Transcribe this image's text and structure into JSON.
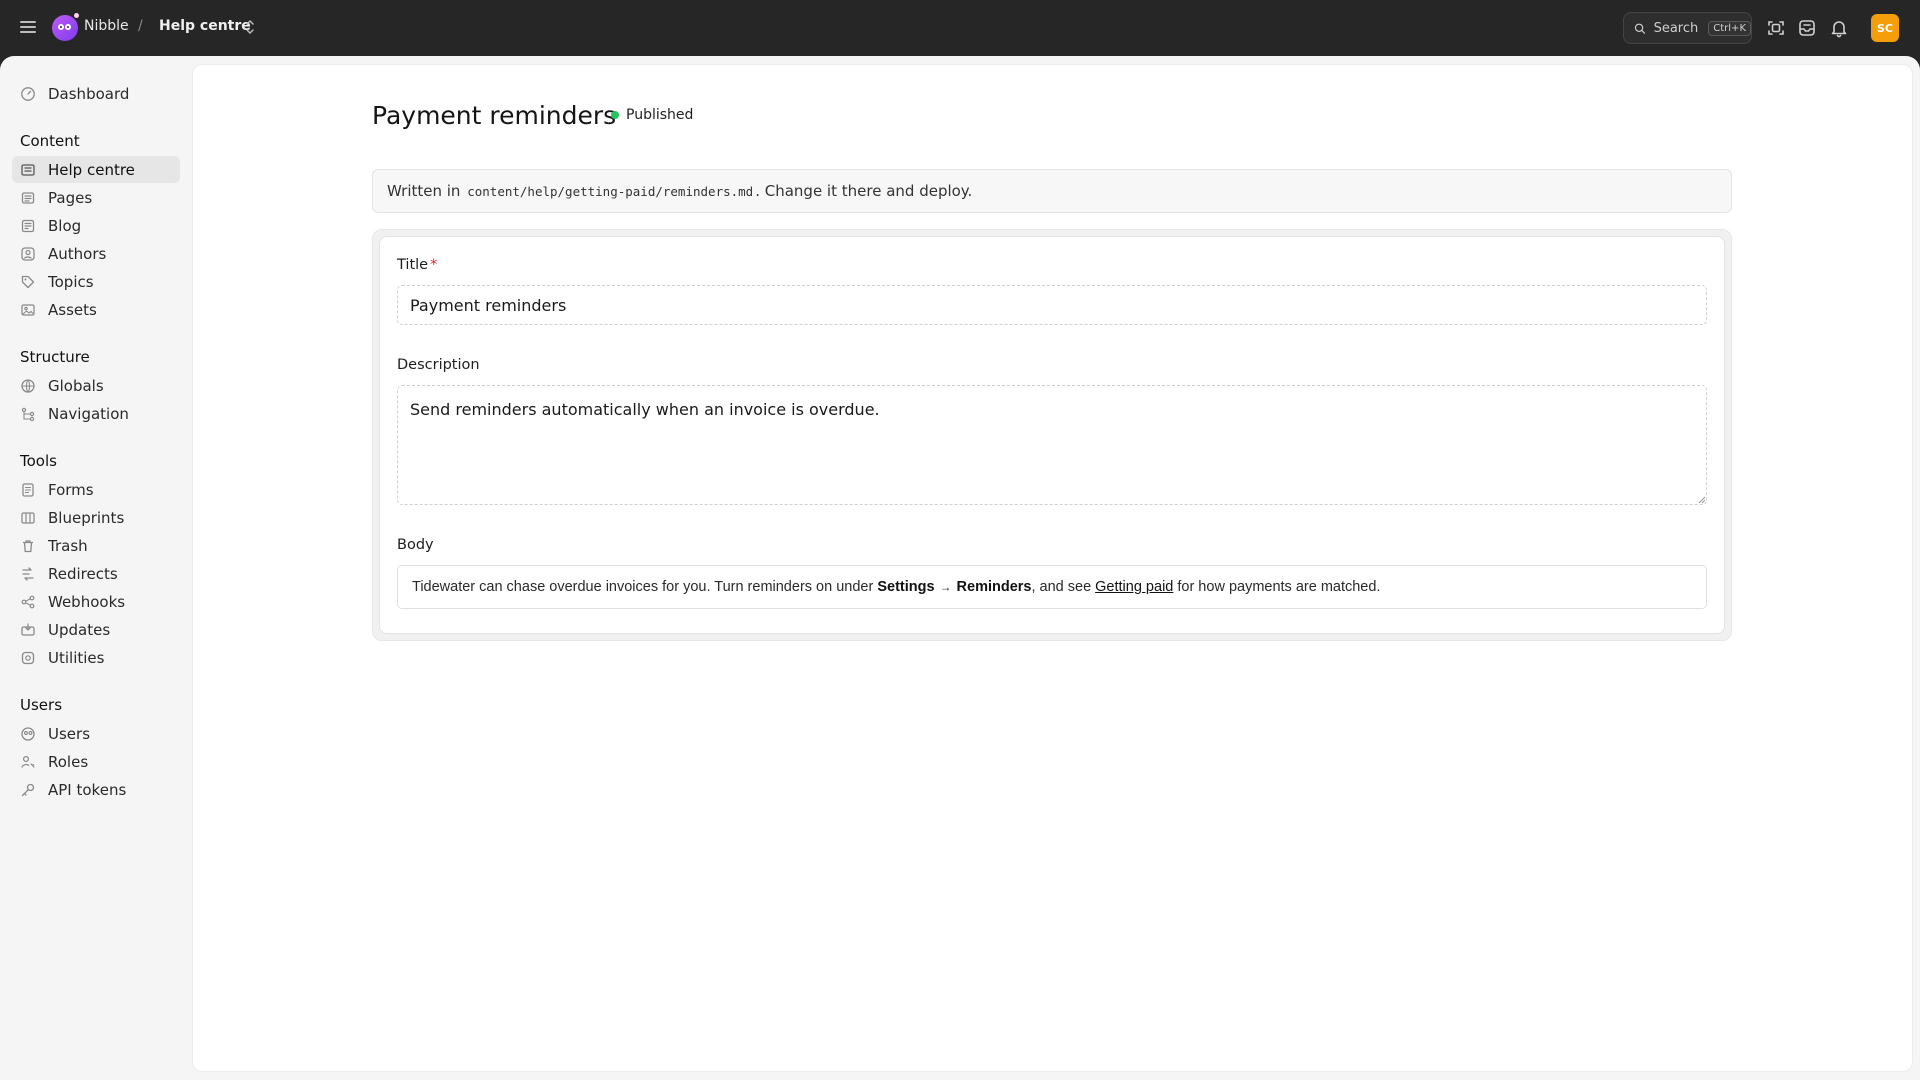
{
  "topbar": {
    "brand": "Nibble",
    "separator": "/",
    "crumb": "Help centre",
    "search_label": "Search",
    "search_shortcut": "Ctrl+K",
    "avatar_initials": "SC"
  },
  "sidebar": {
    "dashboard": "Dashboard",
    "sections": {
      "content": "Content",
      "structure": "Structure",
      "tools": "Tools",
      "users": "Users"
    },
    "content_items": [
      "Help centre",
      "Pages",
      "Blog",
      "Authors",
      "Topics",
      "Assets"
    ],
    "structure_items": [
      "Globals",
      "Navigation"
    ],
    "tools_items": [
      "Forms",
      "Blueprints",
      "Trash",
      "Redirects",
      "Webhooks",
      "Updates",
      "Utilities"
    ],
    "users_items": [
      "Users",
      "Roles",
      "API tokens"
    ],
    "active": "Help centre"
  },
  "page": {
    "title": "Payment reminders",
    "status": "Published",
    "status_color": "#22c55e",
    "notice_prefix": "Written in",
    "notice_path": "content/help/getting-paid/reminders.md",
    "notice_suffix": ". Change it there and deploy."
  },
  "form": {
    "title_label": "Title",
    "required_mark": "*",
    "title_value": "Payment reminders",
    "description_label": "Description",
    "description_value": "Send reminders automatically when an invoice is overdue.",
    "body_label": "Body",
    "body": {
      "text1": "Tidewater can chase overdue invoices for you. Turn reminders on under",
      "bold1": "Settings",
      "arrow": "→",
      "bold2": "Reminders",
      "text2": ", and see",
      "link": "Getting paid",
      "text3": "for how payments are matched."
    }
  },
  "colors": {
    "topbar": "#262626",
    "accent_avatar": "#f59e0b",
    "required": "#dc2626"
  }
}
